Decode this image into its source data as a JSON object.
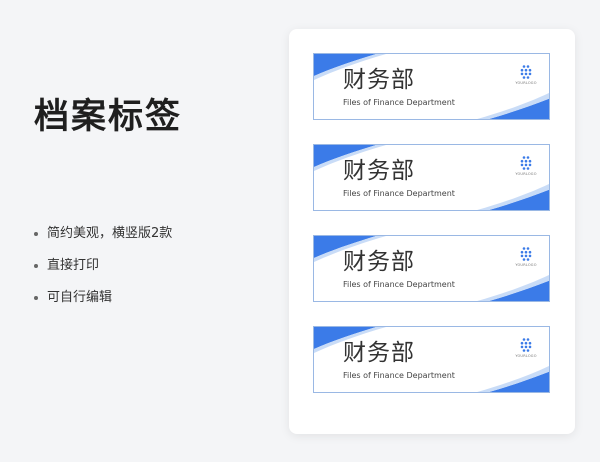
{
  "main": {
    "title": "档案标签",
    "bullets": [
      "简约美观，横竖版2款",
      "直接打印",
      "可自行编辑"
    ]
  },
  "labels": [
    {
      "dept": "财务部",
      "dept_en": "Files of Finance Department",
      "logo_text": "YOURLOGO"
    },
    {
      "dept": "财务部",
      "dept_en": "Files of Finance Department",
      "logo_text": "YOURLOGO"
    },
    {
      "dept": "财务部",
      "dept_en": "Files of Finance Department",
      "logo_text": "YOURLOGO"
    },
    {
      "dept": "财务部",
      "dept_en": "Files of Finance Department",
      "logo_text": "YOURLOGO"
    }
  ],
  "colors": {
    "accent": "#3b7be8",
    "accent_light": "#c9dcf7",
    "border": "#9ab8e4"
  },
  "icons": {
    "logo": "dot-grid-logo-icon",
    "bullet": "bullet-dot-icon"
  }
}
